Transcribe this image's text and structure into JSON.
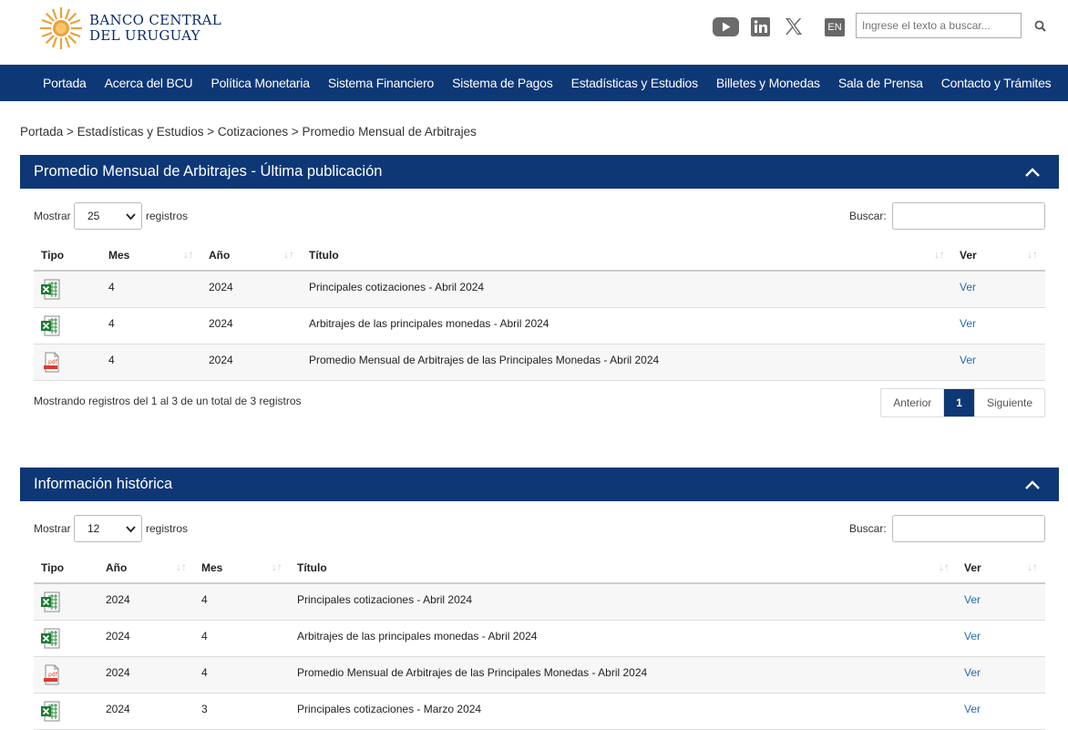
{
  "header": {
    "logo_line1": "BANCO CENTRAL",
    "logo_line2": "DEL URUGUAY",
    "lang": "EN",
    "search_placeholder": "Ingrese el texto a buscar..."
  },
  "nav": [
    "Portada",
    "Acerca del BCU",
    "Política Monetaria",
    "Sistema Financiero",
    "Sistema de Pagos",
    "Estadísticas y Estudios",
    "Billetes y Monedas",
    "Sala de Prensa",
    "Contacto y Trámites"
  ],
  "breadcrumb": "Portada > Estadísticas y Estudios > Cotizaciones > Promedio Mensual de Arbitrajes",
  "panel1": {
    "title": "Promedio Mensual de Arbitrajes - Última publicación",
    "show_label": "Mostrar",
    "show_value": "25",
    "records_label": "registros",
    "search_label": "Buscar:",
    "columns": [
      "Tipo",
      "Mes",
      "Año",
      "Título",
      "Ver"
    ],
    "rows": [
      {
        "type": "xls",
        "mes": "4",
        "anio": "2024",
        "titulo": "Principales cotizaciones - Abril 2024",
        "ver": "Ver"
      },
      {
        "type": "xls",
        "mes": "4",
        "anio": "2024",
        "titulo": "Arbitrajes de las principales monedas - Abril 2024",
        "ver": "Ver"
      },
      {
        "type": "pdf",
        "mes": "4",
        "anio": "2024",
        "titulo": "Promedio Mensual de Arbitrajes de las Principales Monedas - Abril 2024",
        "ver": "Ver"
      }
    ],
    "info": "Mostrando registros del 1 al 3 de un total de 3 registros",
    "prev": "Anterior",
    "page": "1",
    "next": "Siguiente"
  },
  "panel2": {
    "title": "Información histórica",
    "show_label": "Mostrar",
    "show_value": "12",
    "records_label": "registros",
    "search_label": "Buscar:",
    "columns": [
      "Tipo",
      "Año",
      "Mes",
      "Título",
      "Ver"
    ],
    "rows": [
      {
        "type": "xls",
        "anio": "2024",
        "mes": "4",
        "titulo": "Principales cotizaciones - Abril 2024",
        "ver": "Ver"
      },
      {
        "type": "xls",
        "anio": "2024",
        "mes": "4",
        "titulo": "Arbitrajes de las principales monedas - Abril 2024",
        "ver": "Ver"
      },
      {
        "type": "pdf",
        "anio": "2024",
        "mes": "4",
        "titulo": "Promedio Mensual de Arbitrajes de las Principales Monedas - Abril 2024",
        "ver": "Ver"
      },
      {
        "type": "xls",
        "anio": "2024",
        "mes": "3",
        "titulo": "Principales cotizaciones - Marzo 2024",
        "ver": "Ver"
      }
    ]
  },
  "icons": {
    "social": [
      "youtube-icon",
      "linkedin-icon",
      "x-icon"
    ],
    "search": "search-icon",
    "collapse": "chevron-up-icon",
    "file_xls": "excel-file-icon",
    "file_pdf": "pdf-file-icon"
  },
  "colors": {
    "brand": "#0e3776",
    "link": "#2a6ab0",
    "logo_sun": "#e8a33a"
  }
}
